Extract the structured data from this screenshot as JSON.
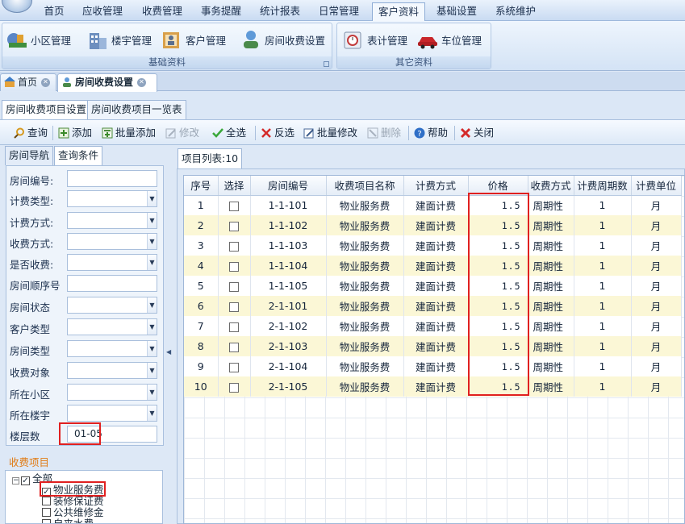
{
  "menu": {
    "items": [
      "首页",
      "应收管理",
      "收费管理",
      "事务提醒",
      "统计报表",
      "日常管理",
      "客户资料",
      "基础设置",
      "系统维护"
    ],
    "active": "客户资料"
  },
  "ribbon": {
    "group1": {
      "caption": "基础资料",
      "buttons": [
        "小区管理",
        "楼宇管理",
        "客户管理",
        "房间收费设置"
      ]
    },
    "group2": {
      "caption": "其它资料",
      "buttons": [
        "表计管理",
        "车位管理"
      ]
    }
  },
  "doc_tabs": [
    "首页",
    "房间收费设置"
  ],
  "sub_tabs": [
    "房间收费项目设置",
    "房间收费项目一览表"
  ],
  "toolbar": {
    "query": "查询",
    "add": "添加",
    "batch_add": "批量添加",
    "modify": "修改",
    "select_all": "全选",
    "invert": "反选",
    "batch_modify": "批量修改",
    "delete": "删除",
    "help": "帮助",
    "close": "关闭"
  },
  "left_tabs": [
    "房间导航",
    "查询条件"
  ],
  "filters": [
    {
      "label": "房间编号:",
      "value": "",
      "dropdown": false
    },
    {
      "label": "计费类型:",
      "value": "",
      "dropdown": true
    },
    {
      "label": "计费方式:",
      "value": "",
      "dropdown": true
    },
    {
      "label": "收费方式:",
      "value": "",
      "dropdown": true
    },
    {
      "label": "是否收费:",
      "value": "",
      "dropdown": true
    },
    {
      "label": "房间顺序号",
      "value": "",
      "dropdown": false
    },
    {
      "label": "房间状态",
      "value": "",
      "dropdown": true
    },
    {
      "label": "客户类型",
      "value": "",
      "dropdown": true
    },
    {
      "label": "房间类型",
      "value": "",
      "dropdown": true
    },
    {
      "label": "收费对象",
      "value": "",
      "dropdown": true
    },
    {
      "label": "所在小区",
      "value": "",
      "dropdown": true
    },
    {
      "label": "所在楼宇",
      "value": "",
      "dropdown": true
    },
    {
      "label": "楼层数",
      "value": "01-05",
      "dropdown": false
    }
  ],
  "fee_items": {
    "title": "收费项目",
    "root": "全部",
    "items": [
      {
        "label": "物业服务费",
        "checked": true
      },
      {
        "label": "装修保证费",
        "checked": false
      },
      {
        "label": "公共维修金",
        "checked": false
      },
      {
        "label": "自来水费",
        "checked": false
      }
    ]
  },
  "grid": {
    "tab": "项目列表:10",
    "columns": [
      "序号",
      "选择",
      "房间编号",
      "收费项目名称",
      "计费方式",
      "价格",
      "收费方式",
      "计费周期数",
      "计费单位"
    ],
    "rows": [
      [
        "1",
        "",
        "1-1-101",
        "物业服务费",
        "建面计费",
        "1.5",
        "周期性",
        "1",
        "月"
      ],
      [
        "2",
        "",
        "1-1-102",
        "物业服务费",
        "建面计费",
        "1.5",
        "周期性",
        "1",
        "月"
      ],
      [
        "3",
        "",
        "1-1-103",
        "物业服务费",
        "建面计费",
        "1.5",
        "周期性",
        "1",
        "月"
      ],
      [
        "4",
        "",
        "1-1-104",
        "物业服务费",
        "建面计费",
        "1.5",
        "周期性",
        "1",
        "月"
      ],
      [
        "5",
        "",
        "1-1-105",
        "物业服务费",
        "建面计费",
        "1.5",
        "周期性",
        "1",
        "月"
      ],
      [
        "6",
        "",
        "2-1-101",
        "物业服务费",
        "建面计费",
        "1.5",
        "周期性",
        "1",
        "月"
      ],
      [
        "7",
        "",
        "2-1-102",
        "物业服务费",
        "建面计费",
        "1.5",
        "周期性",
        "1",
        "月"
      ],
      [
        "8",
        "",
        "2-1-103",
        "物业服务费",
        "建面计费",
        "1.5",
        "周期性",
        "1",
        "月"
      ],
      [
        "9",
        "",
        "2-1-104",
        "物业服务费",
        "建面计费",
        "1.5",
        "周期性",
        "1",
        "月"
      ],
      [
        "10",
        "",
        "2-1-105",
        "物业服务费",
        "建面计费",
        "1.5",
        "周期性",
        "1",
        "月"
      ]
    ]
  },
  "colors": {
    "highlight": "#e02020",
    "alt_row": "#fbf7d6",
    "accent": "#e07a12"
  }
}
